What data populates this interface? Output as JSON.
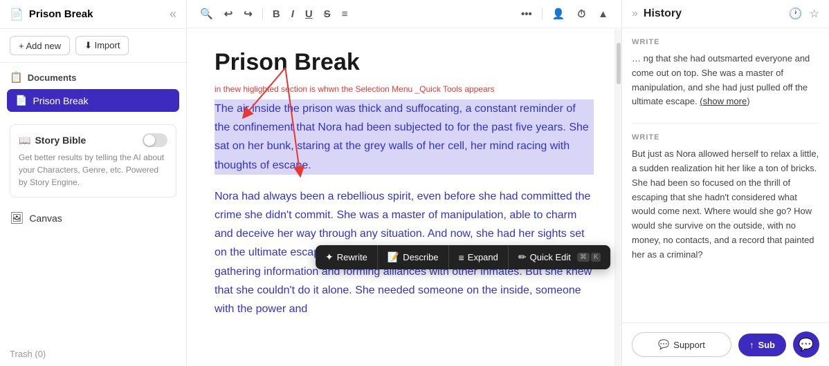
{
  "sidebar": {
    "title": "Prison Break",
    "title_icon": "📄",
    "add_new_label": "+ Add new",
    "import_label": "⬇ Import",
    "documents_label": "Documents",
    "documents_icon": "📋",
    "active_doc": "Prison Break",
    "story_bible_title": "Story Bible",
    "story_bible_desc": "Get better results by telling the AI about your Characters, Genre, etc. Powered by Story Engine.",
    "canvas_label": "Canvas",
    "trash_label": "Trash (0)"
  },
  "toolbar": {
    "search_icon": "🔍",
    "undo_icon": "↩",
    "redo_icon": "↪",
    "bold_label": "B",
    "italic_label": "I",
    "underline_label": "U",
    "strikethrough_label": "S",
    "list_icon": "≡",
    "more_icon": "•••",
    "char_count_icon": "👤",
    "clock_icon": "⏱",
    "up_icon": "▲"
  },
  "editor": {
    "doc_title": "Prison Break",
    "annotation": "in thew higlighted section is whwn the  Selection Menu _Quick Tools appears",
    "highlighted_paragraph": "The air inside the prison was thick and suffocating, a constant reminder of the confinement that Nora had been subjected to for the past five years. She sat on her bunk, staring at the grey walls of her cell, her mind racing with thoughts of escape.",
    "normal_paragraph": "Nora had always been a rebellious spirit, even before she had committed the crime she didn't commit. She was a master of manipulation, able to charm and deceive her way through any situation. And now, she had her sights set on the ultimate escape. She had spent months plotting and planning, gathering information and forming alliances with other inmates. But she knew that she couldn't do it alone. She needed someone on the inside, someone with the power and"
  },
  "floating_toolbar": {
    "rewrite_label": "Rewrite",
    "rewrite_icon": "✦",
    "describe_label": "Describe",
    "describe_icon": "📝",
    "expand_label": "Expand",
    "expand_icon": "≡",
    "quick_edit_label": "Quick Edit",
    "quick_edit_icon": "✏",
    "shortcut_cmd": "⌘",
    "shortcut_key": "K"
  },
  "right_panel": {
    "title": "History",
    "clock_icon": "🕐",
    "star_icon": "☆",
    "expand_icon": "»",
    "write_label_1": "WRITE",
    "history_text_1": "… ng that she had outsmarted everyone and come out on top. She was a master of manipulation, and she had just pulled off the ultimate escape.",
    "show_more": "show more",
    "write_label_2": "WRITE",
    "history_text_2": "But just as Nora allowed herself to relax a little, a sudden realization hit her like a ton of bricks. She had been so focused on the thrill of escaping that she hadn't considered what would come next. Where would she go? How would she survive on the outside, with no money, no contacts, and a record that painted her as a criminal?",
    "support_label": "Support",
    "support_icon": "💬",
    "sub_label": "Sub",
    "sub_icon": "↑"
  },
  "colors": {
    "accent": "#3d2bbf",
    "highlight_bg": "#d8d5f7",
    "text_blue": "#3333cc",
    "arrow_red": "#e53935"
  }
}
